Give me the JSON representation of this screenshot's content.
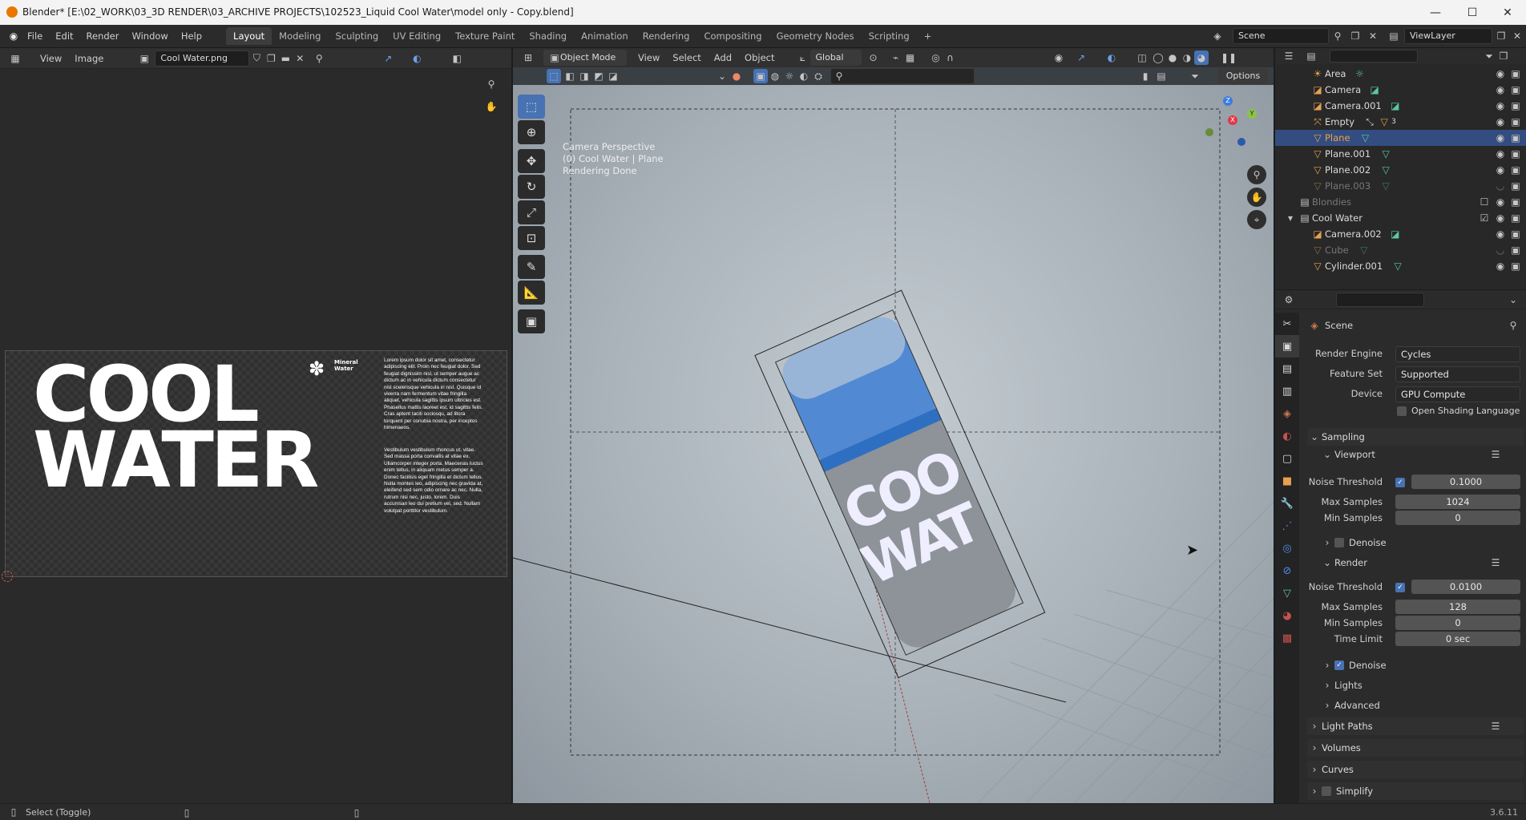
{
  "titlebar": {
    "title": "Blender* [E:\\02_WORK\\03_3D RENDER\\03_ARCHIVE PROJECTS\\102523_Liquid Cool Water\\model only - Copy.blend]",
    "minimize": "—",
    "maximize": "☐",
    "close": "✕"
  },
  "menu": [
    "File",
    "Edit",
    "Render",
    "Window",
    "Help"
  ],
  "workspaces": [
    "Layout",
    "Modeling",
    "Sculpting",
    "UV Editing",
    "Texture Paint",
    "Shading",
    "Animation",
    "Rendering",
    "Compositing",
    "Geometry Nodes",
    "Scripting"
  ],
  "add_workspace": "+",
  "scene_name": "Scene",
  "view_layer": "ViewLayer",
  "image_editor": {
    "view": "View",
    "image": "Image",
    "image_name": "Cool Water.png",
    "art_line1": "COOL",
    "art_line2": "WATER",
    "brand_line1": "Mineral",
    "brand_line2": "Water",
    "body1": "Lorem ipsum dolor sit amet, consectetur adipiscing elit. Proin nec feugiat dolor. Sed feugiat dignissim nisl, ut semper augue ac dictum ac in vehicula dictum consectetur nisl scelerisque vehicula in nisl. Quisque id viverra nam fermentum vitae fringilla aliquet, vehicula sagittis ipsum ultricies est. Phasellus mattis laoreet est, id sagittis felis. Cras aptent taciti sociosqu, ad litora torquent per conubia nostra, per inceptos himenaeos.",
    "body2": "Vestibulum vestibulum rhoncus ut, vitae. Sed massa porta convallis at vitae ex. Ullamcorper integer porta. Maecenas luctus enim tellus, in aliquam metus semper a. Donec facilisis eget fringilla et dictum tellus. Nulla montes leo, adipiscing nec gravida at, eleifend sed sem odio ornare ac nec. Nulla, rutrum nisi nec, justo, lorem. Duis accumsan leo dui pretium vel, sed. Nullam volutpat porttitor vestibulum."
  },
  "viewport": {
    "mode": "Object Mode",
    "menus": [
      "View",
      "Select",
      "Add",
      "Object"
    ],
    "transform": "Global",
    "options": "Options",
    "overlay_line1": "Camera Perspective",
    "overlay_line2": "(0) Cool Water | Plane",
    "overlay_line3": "Rendering Done",
    "can_text_top": "COO",
    "can_text_bottom": "WAT"
  },
  "outliner": {
    "items": [
      {
        "name": "Area"
      },
      {
        "name": "Camera"
      },
      {
        "name": "Camera.001"
      },
      {
        "name": "Empty",
        "badge": "3"
      },
      {
        "name": "Plane"
      },
      {
        "name": "Plane.001"
      },
      {
        "name": "Plane.002"
      },
      {
        "name": "Plane.003"
      },
      {
        "name": "Blondies"
      },
      {
        "name": "Cool Water"
      },
      {
        "name": "Camera.002"
      },
      {
        "name": "Cube"
      },
      {
        "name": "Cylinder.001"
      }
    ]
  },
  "properties": {
    "context": "Scene",
    "render_engine_label": "Render Engine",
    "render_engine": "Cycles",
    "feature_set_label": "Feature Set",
    "feature_set": "Supported",
    "device_label": "Device",
    "device": "GPU Compute",
    "osl": "Open Shading Language",
    "sampling": "Sampling",
    "viewport": "Viewport",
    "noise_threshold_label": "Noise Threshold",
    "vp_noise_threshold": "0.1000",
    "max_samples_label": "Max Samples",
    "vp_max_samples": "1024",
    "min_samples_label": "Min Samples",
    "vp_min_samples": "0",
    "denoise": "Denoise",
    "render": "Render",
    "r_noise_threshold": "0.0100",
    "r_max_samples": "128",
    "r_min_samples": "0",
    "time_limit_label": "Time Limit",
    "time_limit": "0 sec",
    "lights": "Lights",
    "advanced": "Advanced",
    "light_paths": "Light Paths",
    "volumes": "Volumes",
    "curves": "Curves",
    "simplify": "Simplify"
  },
  "statusbar": {
    "hint": "Select (Toggle)",
    "version": "3.6.11"
  },
  "colors": {
    "accent": "#4772b3",
    "selection": "#334d80"
  }
}
